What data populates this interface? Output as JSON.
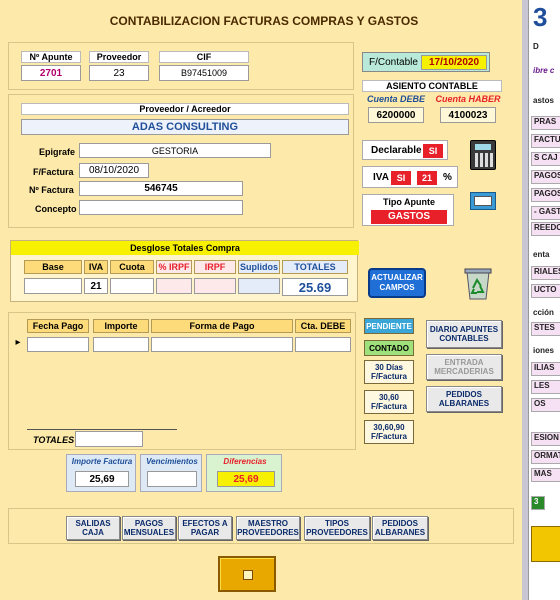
{
  "title": "CONTABILIZACION FACTURAS COMPRAS Y GASTOS",
  "header": {
    "apunte_label": "Nº Apunte",
    "apunte_value": "2701",
    "proveedor_label": "Proveedor",
    "proveedor_value": "23",
    "cif_label": "CIF",
    "cif_value": "B97451009",
    "fcontable_label": "F/Contable",
    "fcontable_value": "17/10/2020"
  },
  "asiento": {
    "title": "ASIENTO CONTABLE",
    "debe_label": "Cuenta DEBE",
    "debe_value": "6200000",
    "haber_label": "Cuenta HABER",
    "haber_value": "4100023"
  },
  "proveedor": {
    "section_label": "Proveedor / Acreedor",
    "name": "ADAS CONSULTING",
    "epigrafe_label": "Epigrafe",
    "epigrafe_value": "GESTORIA",
    "ffactura_label": "F/Factura",
    "ffactura_value": "08/10/2020",
    "nfactura_label": "Nº Factura",
    "nfactura_value": "546745",
    "concepto_label": "Concepto",
    "concepto_value": ""
  },
  "flags": {
    "declarable_label": "Declarable",
    "declarable_value": "SI",
    "iva_label": "IVA",
    "iva_value": "SI",
    "iva_pct": "21",
    "pct_sign": "%",
    "tipo_label": "Tipo Apunte",
    "tipo_value": "GASTOS"
  },
  "desglose": {
    "title": "Desglose Totales Compra",
    "headers": [
      "Base",
      "IVA",
      "Cuota",
      "% IRPF",
      "IRPF",
      "Suplidos",
      "TOTALES"
    ],
    "iva_value": "21",
    "total_value": "25.69"
  },
  "actualizar_label": "ACTUALIZAR CAMPOS",
  "pagos": {
    "headers": [
      "Fecha Pago",
      "Importe",
      "Forma de Pago",
      "Cta. DEBE"
    ],
    "totales_label": "TOTALES"
  },
  "pay_buttons": [
    "PENDIENTE",
    "CONTADO",
    "30 Días F/Factura",
    "30,60 F/Factura",
    "30,60,90 F/Factura"
  ],
  "side_buttons": [
    "DIARIO APUNTES CONTABLES",
    "ENTRADA MERCADERIAS",
    "PEDIDOS ALBARANES"
  ],
  "resumen": {
    "importe_label": "Importe Factura",
    "importe_value": "25,69",
    "venc_label": "Vencimientos",
    "venc_value": "",
    "dif_label": "Diferencias",
    "dif_value": "25,69"
  },
  "bottom_buttons": [
    "SALIDAS CAJA",
    "PAGOS MENSUALES",
    "EFECTOS A PAGAR",
    "MAESTRO PROVEEDORES",
    "TIPOS PROVEEDORES",
    "PEDIDOS ALBARANES"
  ],
  "right_panel": {
    "big_digit": "3",
    "items": [
      "D",
      "ibre c",
      "astos",
      "PRAS",
      "FACTU",
      "S CAJ",
      "PAGOS",
      "PAGOS",
      "- GAST",
      "REEDO",
      "enta",
      "RIALES",
      "UCTO",
      "cción",
      "STES",
      "iones",
      "ILIAS",
      "LES",
      "OS",
      "ESION",
      "ORMAT",
      "MAS",
      "3"
    ]
  },
  "colors": {
    "accent_yellow": "#f7f000",
    "red": "#e8202a",
    "blue_header": "#1f4f9a"
  }
}
